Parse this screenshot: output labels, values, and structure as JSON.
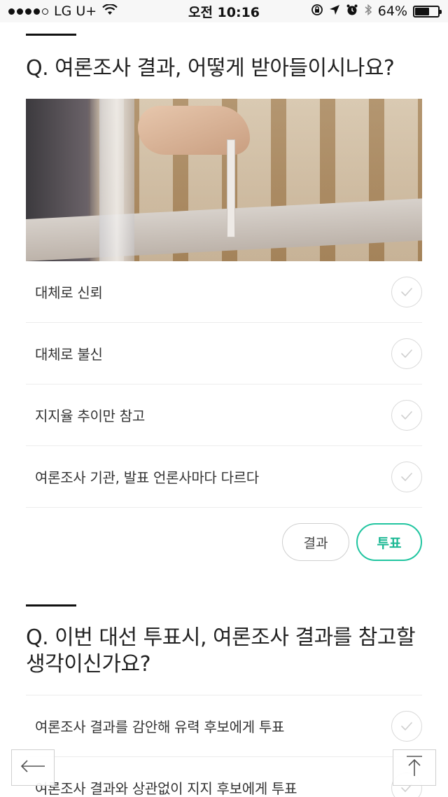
{
  "status_bar": {
    "carrier": "LG U+",
    "time": "오전 10:16",
    "battery": "64%",
    "battery_level": 0.64
  },
  "poll1": {
    "question": "Q. 여론조사 결과, 어떻게 받아들이시나요?",
    "image_icon": "ballot-box-photo",
    "options": [
      {
        "label": "대체로 신뢰"
      },
      {
        "label": "대체로 불신"
      },
      {
        "label": "지지율 추이만 참고"
      },
      {
        "label": "여론조사 기관, 발표 언론사마다 다르다"
      }
    ],
    "result_label": "결과",
    "vote_label": "투표"
  },
  "poll2": {
    "question": "Q. 이번 대선 투표시, 여론조사 결과를 참고할 생각이신가요?",
    "options": [
      {
        "label": "여론조사 결과를 감안해 유력 후보에게 투표"
      },
      {
        "label": "여론조사 결과와 상관없이 지지 후보에게 투표"
      }
    ]
  },
  "floating": {
    "back_icon": "arrow-left-icon",
    "top_icon": "arrow-up-to-top-icon"
  },
  "colors": {
    "accent": "#21c5a0",
    "divider": "#ececec",
    "check_border": "#d9d9d9"
  }
}
